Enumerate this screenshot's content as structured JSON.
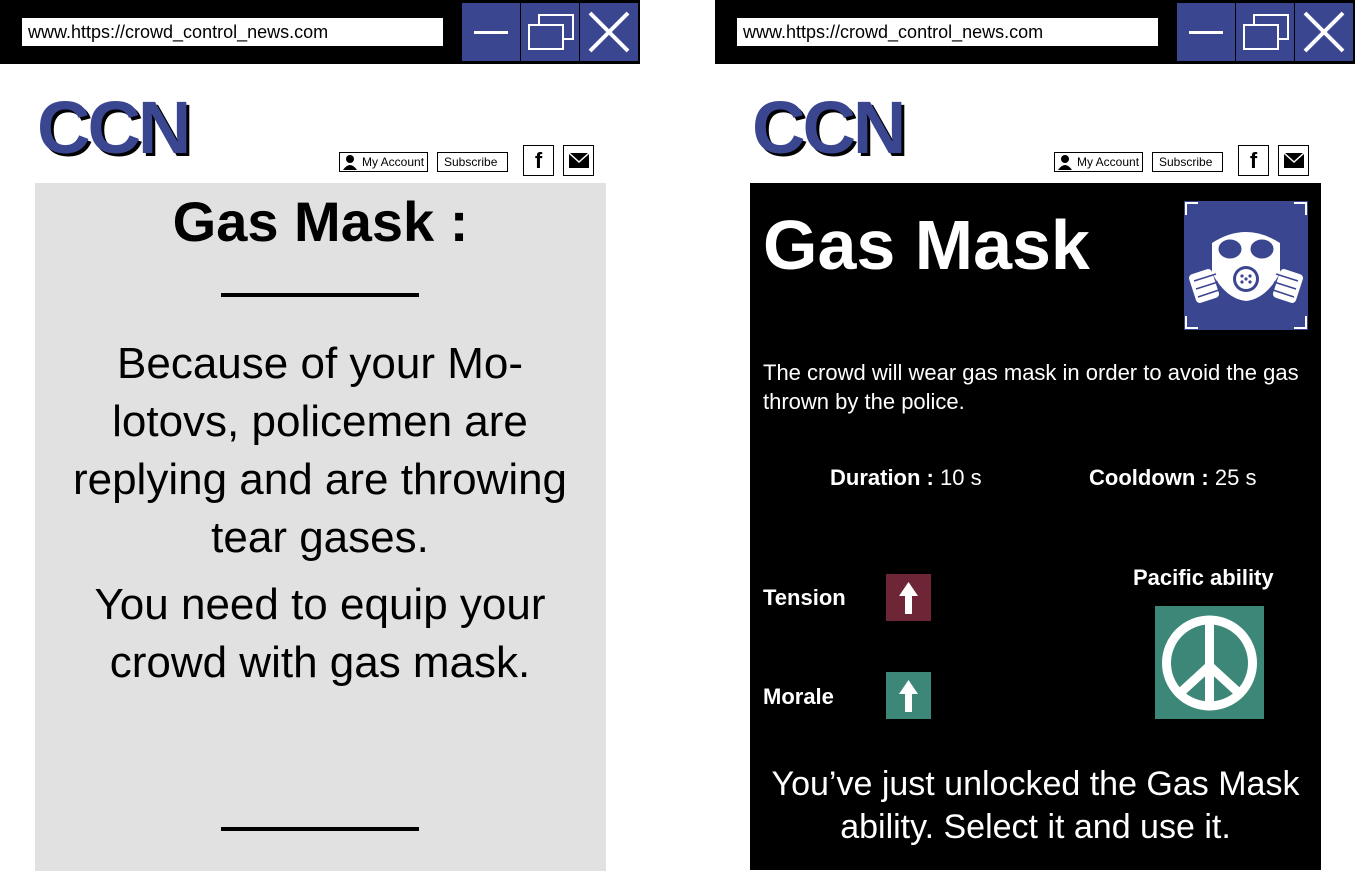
{
  "browser": {
    "url": "www.https://crowd_control_news.com",
    "minimize_icon": "minimize-icon",
    "maximize_icon": "restore-icon",
    "close_icon": "close-icon",
    "button_color": "#3b4690"
  },
  "header": {
    "logo": "CCN",
    "logo_color": "#3b4690",
    "my_account": "My Account",
    "subscribe": "Subscribe",
    "facebook": "f",
    "mail_icon": "mail-icon"
  },
  "left_panel": {
    "title": "Gas Mask :",
    "paragraph_1": "Because of your Mo-lotovs, policemen are replying and are throwing tear gases.",
    "paragraph_2": "You need to equip your crowd with gas mask.",
    "background": "#e1e1e1"
  },
  "right_panel": {
    "title": "Gas Mask",
    "icon": "gas-mask-icon",
    "description": "The crowd will wear gas mask in order to avoid the gas thrown by the police.",
    "duration_label": "Duration :",
    "duration_value": "10 s",
    "cooldown_label": "Cooldown :",
    "cooldown_value": "25 s",
    "tension_label": "Tension",
    "tension_color": "#6e2536",
    "morale_label": "Morale",
    "morale_color": "#3c8777",
    "pacific_label": "Pacific ability",
    "pacific_icon": "peace-icon",
    "pacific_color": "#3c8777",
    "footer": "You’ve just unlocked the Gas Mask ability. Select it and use it."
  }
}
